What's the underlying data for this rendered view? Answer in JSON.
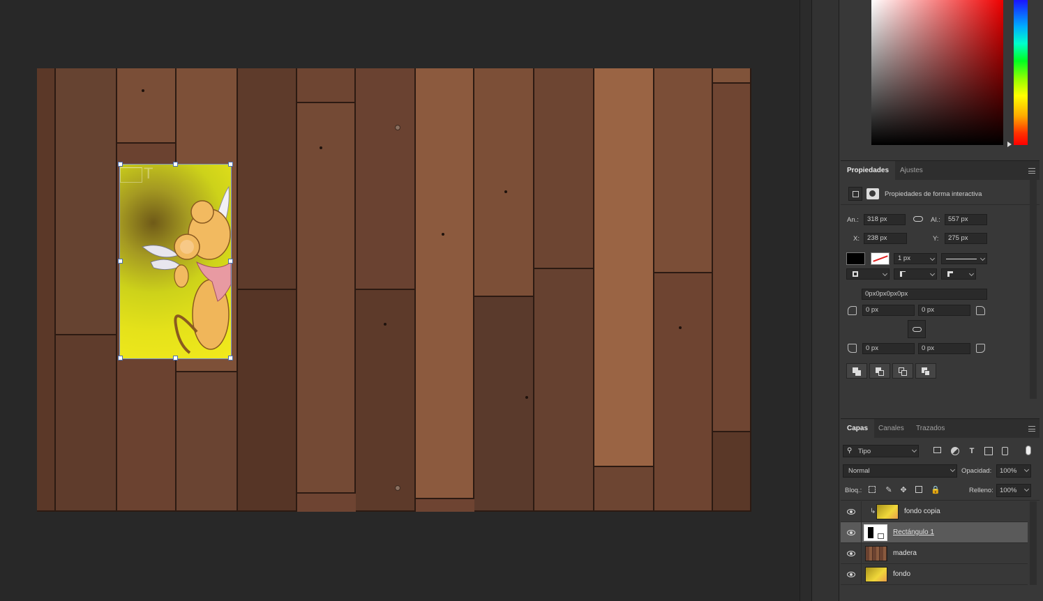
{
  "canvas": {
    "document_label": "Madera background with rectangle mask",
    "shape_overlay_text": "T"
  },
  "properties_panel": {
    "tabs": [
      {
        "label": "Propiedades",
        "active": true
      },
      {
        "label": "Ajustes",
        "active": false
      }
    ],
    "subtitle": "Propiedades de forma interactiva",
    "width_label": "An.:",
    "width_value": "318 px",
    "height_label": "Al.:",
    "height_value": "557 px",
    "x_label": "X:",
    "x_value": "238 px",
    "y_label": "Y:",
    "y_value": "275 px",
    "stroke_width": "1 px",
    "corner_radius_all": "0px0px0px0px",
    "corner_tl": "0 px",
    "corner_tr": "0 px",
    "corner_bl": "0 px",
    "corner_br": "0 px",
    "fill_color": "#000000"
  },
  "layers_panel": {
    "tabs": [
      {
        "label": "Capas",
        "active": true
      },
      {
        "label": "Canales",
        "active": false
      },
      {
        "label": "Trazados",
        "active": false
      }
    ],
    "filter_label": "Tipo",
    "blend_mode": "Normal",
    "opacity_label": "Opacidad:",
    "opacity_value": "100%",
    "lock_label": "Bloq.:",
    "fill_label": "Relleno:",
    "fill_value": "100%",
    "layers": [
      {
        "name": "fondo copia",
        "visible": true,
        "selected": false,
        "clipped": true
      },
      {
        "name": "Rectángulo 1",
        "visible": true,
        "selected": true,
        "clipped": false
      },
      {
        "name": "madera",
        "visible": true,
        "selected": false,
        "clipped": false
      },
      {
        "name": "fondo",
        "visible": true,
        "selected": false,
        "clipped": false
      }
    ]
  }
}
